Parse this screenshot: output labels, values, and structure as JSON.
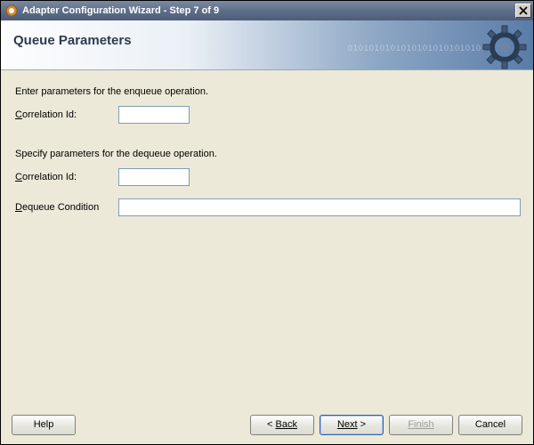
{
  "window": {
    "title": "Adapter Configuration Wizard - Step 7 of 9"
  },
  "header": {
    "title": "Queue Parameters",
    "binary_deco": "0101010101010101010101010101"
  },
  "content": {
    "enqueue_instr": "Enter parameters for the enqueue operation.",
    "dequeue_instr": "Specify parameters for the dequeue operation.",
    "labels": {
      "corr_prefix": "C",
      "corr_rest": "orrelation Id:",
      "deq_prefix": "D",
      "deq_rest": "equeue Condition"
    },
    "values": {
      "enq_corr": "",
      "deq_corr": "",
      "deq_cond": ""
    }
  },
  "footer": {
    "help": "Help",
    "back": "Back",
    "next": "Next",
    "finish": "Finish",
    "cancel": "Cancel",
    "lt": "< ",
    "gt": " >"
  }
}
